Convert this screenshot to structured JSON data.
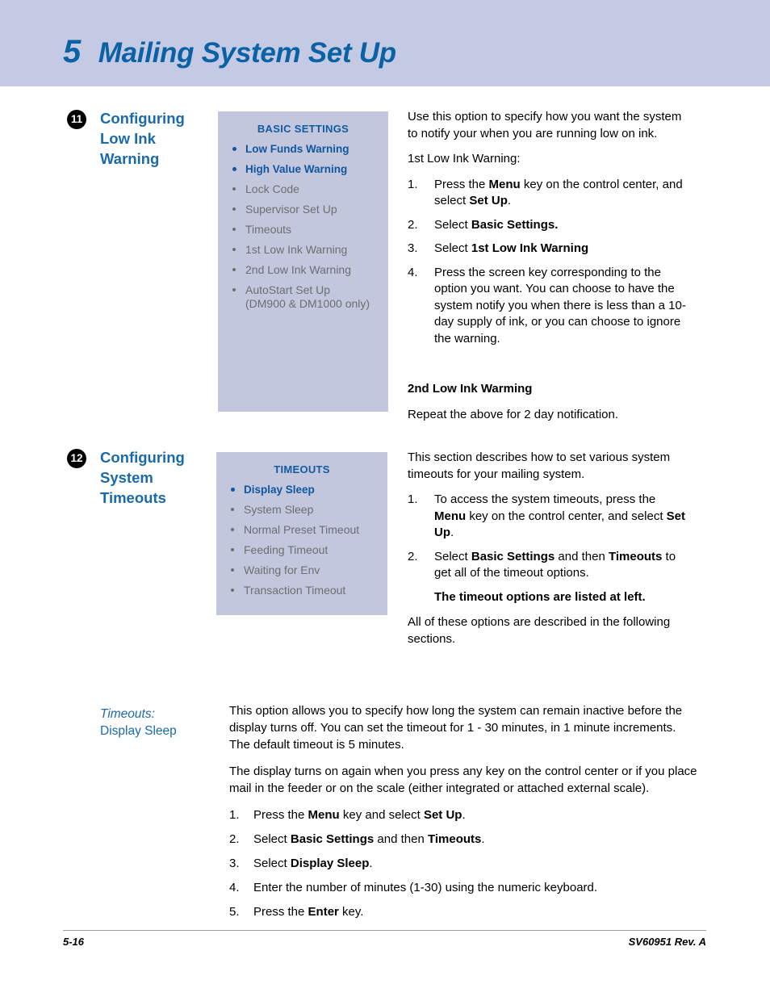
{
  "chapter": {
    "number": "5",
    "title": "Mailing System Set Up"
  },
  "sections": [
    {
      "badge": "11",
      "heading": "Configuring Low Ink Warning",
      "callout": {
        "title": "BASIC SETTINGS",
        "items": [
          {
            "label": "Low Funds Warning",
            "highlight": true
          },
          {
            "label": "High Value Warning",
            "highlight": true
          },
          {
            "label": "Lock Code",
            "highlight": false
          },
          {
            "label": "Supervisor Set Up",
            "highlight": false
          },
          {
            "label": "Timeouts",
            "highlight": false
          },
          {
            "label": "1st Low Ink Warning",
            "highlight": false
          },
          {
            "label": "2nd Low Ink Warning",
            "highlight": false
          },
          {
            "label": "AutoStart Set Up",
            "sub": "(DM900 & DM1000 only)",
            "highlight": false
          }
        ]
      },
      "intro": "Use this option to specify how you want the system to notify your when you are running low on ink.",
      "subintro": "1st Low Ink Warning:",
      "steps": [
        {
          "num": "1.",
          "pre": "Press the ",
          "bold1": "Menu",
          "mid": " key on the control center, and select ",
          "bold2": "Set Up",
          "post": "."
        },
        {
          "num": "2.",
          "pre": "Select ",
          "bold1": "Basic Settings.",
          "mid": "",
          "bold2": "",
          "post": ""
        },
        {
          "num": "3.",
          "pre": "Select ",
          "bold1": "1st Low Ink Warning",
          "mid": "",
          "bold2": "",
          "post": ""
        },
        {
          "num": "4.",
          "pre": "Press the screen key corresponding to the option you want. You can choose to have the system notify you when there is less than a 10-day supply of ink, or you can choose to ignore the warning.",
          "bold1": "",
          "mid": "",
          "bold2": "",
          "post": ""
        }
      ],
      "trailing_heading": "2nd Low Ink Warming",
      "trailing_text": "Repeat the above for 2 day notification."
    },
    {
      "badge": "12",
      "heading": "Configuring System Timeouts",
      "callout": {
        "title": "TIMEOUTS",
        "items": [
          {
            "label": "Display Sleep",
            "highlight": true
          },
          {
            "label": "System Sleep",
            "highlight": false
          },
          {
            "label": "Normal Preset Timeout",
            "highlight": false
          },
          {
            "label": "Feeding Timeout",
            "highlight": false
          },
          {
            "label": "Waiting for Env",
            "highlight": false
          },
          {
            "label": "Transaction Timeout",
            "highlight": false
          }
        ]
      },
      "intro": "This section describes how to set various system timeouts for your mailing system.",
      "steps": [
        {
          "num": "1.",
          "pre": "To access the system timeouts, press the ",
          "bold1": "Menu",
          "mid": " key on the control center, and select ",
          "bold2": "Set Up",
          "post": "."
        },
        {
          "num": "2.",
          "pre": "Select ",
          "bold1": "Basic Settings",
          "mid": " and then ",
          "bold2": "Timeouts",
          "post": " to get all of the timeout options.",
          "note": "The timeout options are listed at left."
        }
      ],
      "outro": "All of these options are described in the following sections."
    }
  ],
  "subsection": {
    "label_italic": "Timeouts:",
    "label_regular": "Display Sleep",
    "paragraphs": [
      "This option allows you to specify how long the system can remain inactive before the display turns off. You can set the timeout for 1 - 30 minutes, in 1 minute increments. The default timeout is 5 minutes.",
      "The display turns on again when you press any key on the control center or if you place mail in the feeder or on the scale (either integrated or attached external scale)."
    ],
    "steps": [
      {
        "num": "1.",
        "pre": "Press the ",
        "bold1": "Menu",
        "mid": " key and select ",
        "bold2": "Set Up",
        "post": "."
      },
      {
        "num": "2.",
        "pre": "Select ",
        "bold1": "Basic Settings",
        "mid": " and then ",
        "bold2": "Timeouts",
        "post": "."
      },
      {
        "num": "3.",
        "pre": "Select ",
        "bold1": "Display Sleep",
        "mid": "",
        "bold2": "",
        "post": "."
      },
      {
        "num": "4.",
        "pre": "Enter the number of minutes (1-30) using the numeric keyboard.",
        "bold1": "",
        "mid": "",
        "bold2": "",
        "post": ""
      },
      {
        "num": "5.",
        "pre": "Press the ",
        "bold1": "Enter",
        "mid": " key.",
        "bold2": "",
        "post": ""
      }
    ]
  },
  "footer": {
    "page_number": "5-16",
    "doc_id": "SV60951 Rev. A"
  },
  "colors": {
    "band": "#c5cae4",
    "heading_blue": "#1a6aab",
    "callout_bg": "#c2c7de",
    "callout_title_blue": "#135b9e",
    "muted_gray": "#6e6e70"
  }
}
